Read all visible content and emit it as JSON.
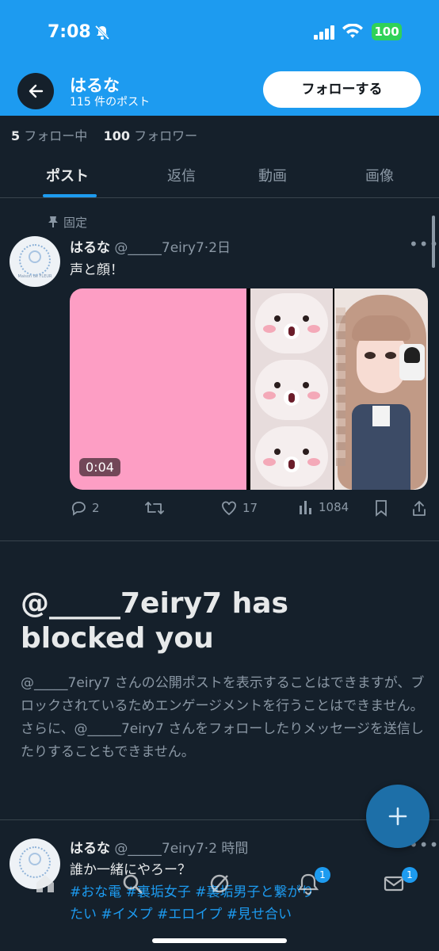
{
  "status_bar": {
    "time": "7:08",
    "battery": "100"
  },
  "header": {
    "name": "はるな",
    "post_count": "115 件のポスト",
    "follow_button": "フォローする"
  },
  "profile_stats": {
    "following_count": "5",
    "following_label": "フォロー中",
    "followers_count": "100",
    "followers_label": "フォロワー"
  },
  "tabs": [
    {
      "label": "ポスト",
      "active": true
    },
    {
      "label": "返信",
      "active": false
    },
    {
      "label": "動画",
      "active": false
    },
    {
      "label": "画像",
      "active": false
    }
  ],
  "pinned_tweet": {
    "pinned_label": "固定",
    "name": "はるな",
    "handle": "@_____7eiry7",
    "time": "2日",
    "text": "声と顔！",
    "video_duration": "0:04",
    "replies": "2",
    "likes": "17",
    "views": "1084"
  },
  "blocked_notice": {
    "title": "@_____7eiry7 has blocked you",
    "description": "@_____7eiry7 さんの公開ポストを表示することはできますが、ブロックされているためエンゲージメントを行うことはできません。さらに、@_____7eiry7 さんをフォローしたりメッセージを送信したりすることもできません。"
  },
  "second_tweet": {
    "name": "はるな",
    "handle": "@_____7eiry7",
    "time": "2 時間",
    "text": "誰か一緒にやろー？",
    "hashtags": "#おな電 #裏垢女子 #裏垢男子と繋がりたい #イメプ #エロイプ #見せ合い"
  },
  "bottom_nav": {
    "notifications_badge": "1",
    "messages_badge": "1"
  },
  "avatar_caption": "Maison de FLEUR",
  "colors": {
    "accent": "#1d9bf0",
    "background": "#15202b",
    "muted": "#8b98a5"
  }
}
